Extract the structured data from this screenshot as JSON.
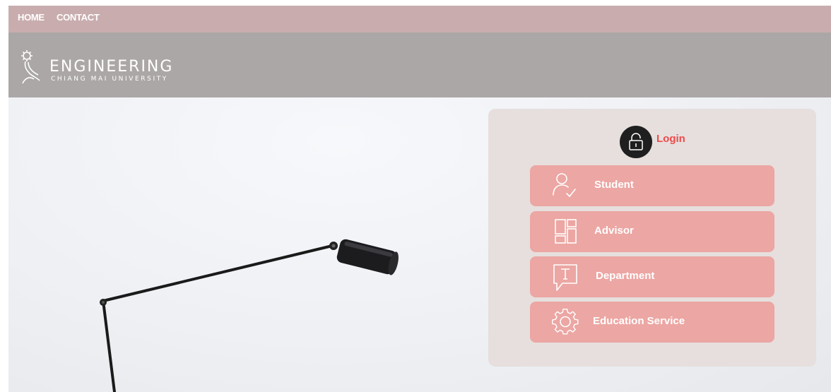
{
  "nav": {
    "home": "HOME",
    "contact": "CONTACT"
  },
  "logo": {
    "main": "ENGINEERING",
    "sub": "CHIANG MAI UNIVERSITY"
  },
  "login": {
    "title": "Login",
    "buttons": [
      {
        "label": "Student",
        "icon": "user-check-icon"
      },
      {
        "label": "Advisor",
        "icon": "layout-grid-icon"
      },
      {
        "label": "Department",
        "icon": "message-text-icon"
      },
      {
        "label": "Education Service",
        "icon": "gear-icon"
      }
    ]
  },
  "colors": {
    "nav_bg": "#c9adae",
    "header_bg": "#aba7a6",
    "panel_bg": "#e6dfdd",
    "button_bg": "#eca6a3",
    "login_accent": "#ee4b4b"
  }
}
